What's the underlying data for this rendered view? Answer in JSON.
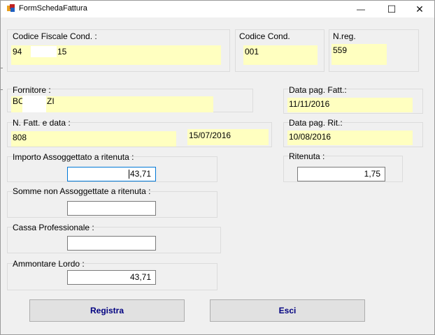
{
  "window": {
    "title": "FormSchedaFattura",
    "minimize_glyph": "—",
    "maximize_glyph": "☐",
    "close_glyph": "✕"
  },
  "condominio": {
    "codice_fiscale_label": "Codice Fiscale Cond. :",
    "codice_fiscale_start": "94",
    "codice_fiscale_end": "15",
    "codice_cond_label": "Codice Cond.",
    "codice_cond_value": "001",
    "nreg_label": "N.reg.",
    "nreg_value": "559"
  },
  "fornitore": {
    "label": "Fornitore :",
    "value_start": "BC",
    "value_end": "ZI"
  },
  "pagamento": {
    "data_pag_fatt_label": "Data pag. Fatt.:",
    "data_pag_fatt_value": "11/11/2016",
    "data_pag_rit_label": "Data pag. Rit.:",
    "data_pag_rit_value": "10/08/2016"
  },
  "fattura": {
    "label": "N. Fatt. e data :",
    "numero": "808",
    "data": "15/07/2016"
  },
  "importi": {
    "importo_label": "Importo Assoggettato a ritenuta :",
    "importo_value": "43,71",
    "ritenuta_label": "Ritenuta :",
    "ritenuta_value": "1,75",
    "somme_label": "Somme non Assoggettate a ritenuta :",
    "somme_value": "",
    "cassa_label": "Cassa Professionale :",
    "cassa_value": "",
    "lordo_label": "Ammontare Lordo :",
    "lordo_value": "43,71"
  },
  "buttons": {
    "registra": "Registra",
    "esci": "Esci"
  },
  "colors": {
    "field_yellow": "#ffffc0",
    "button_text": "#000080",
    "focus_border": "#0078d7"
  }
}
